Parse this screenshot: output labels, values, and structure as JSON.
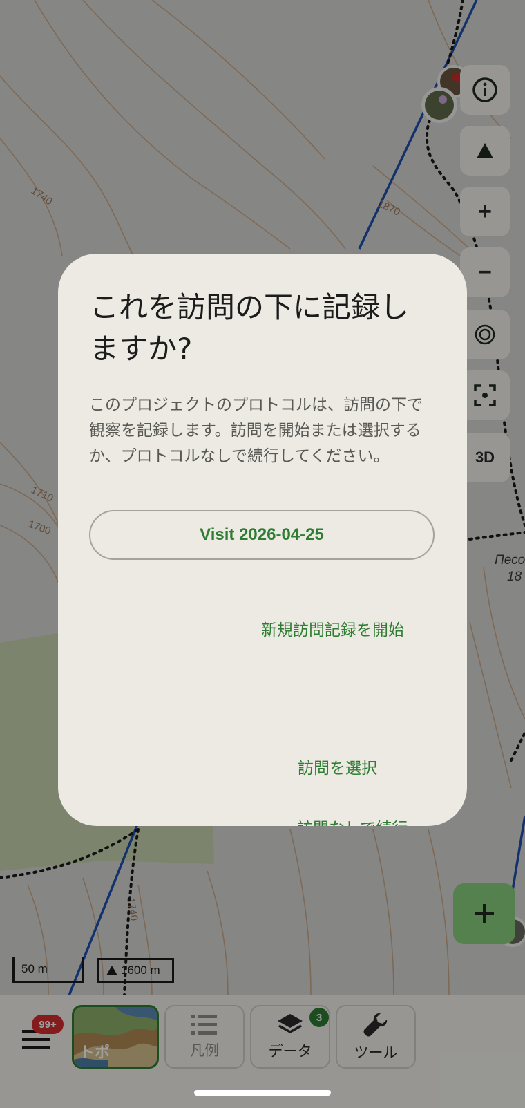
{
  "map": {
    "contour_labels": [
      "1740",
      "1870",
      "1710",
      "1700",
      "1740"
    ],
    "place_label_line1": "Песо",
    "place_label_line2": "18",
    "scale": "50 m",
    "altitude": "1600 m"
  },
  "map_controls": [
    {
      "name": "info-icon"
    },
    {
      "name": "triangle-icon"
    },
    {
      "label": "+"
    },
    {
      "label": "−"
    },
    {
      "name": "target-icon"
    },
    {
      "name": "focus-frame-icon"
    },
    {
      "label": "3D"
    }
  ],
  "dialog": {
    "title": "これを訪問の下に記録しますか?",
    "body": "このプロジェクトのプロトコルは、訪問の下で観察を記録します。訪問を開始または選択するか、プロトコルなしで続行してください。",
    "visit_button": "Visit 2026-04-25",
    "start_new": "新規訪問記録を開始",
    "select_visit": "訪問を選択",
    "continue_without": "訪問なしで続行"
  },
  "bottom_bar": {
    "menu_badge": "99+",
    "topo_label": "トポ",
    "legend_label": "凡例",
    "data_label": "データ",
    "data_badge": "3",
    "tools_label": "ツール"
  },
  "colors": {
    "accent_green": "#2e7d32",
    "badge_red": "#d32f2f",
    "fab_green": "#8ad07f",
    "route_blue": "#1e4fb0"
  }
}
